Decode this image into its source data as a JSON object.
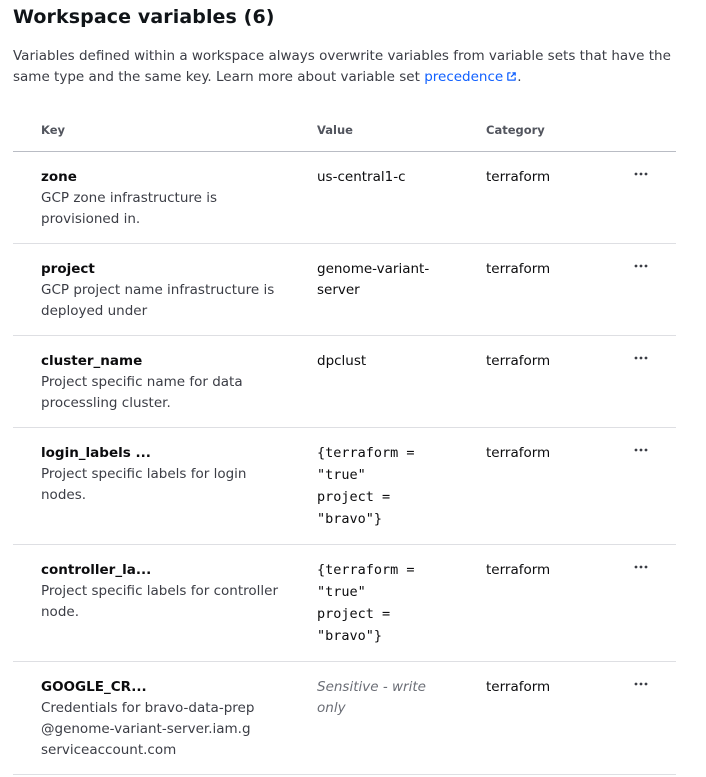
{
  "header": {
    "title": "Workspace variables (6)"
  },
  "intro": {
    "text": "Variables defined within a workspace always overwrite variables from variable sets that have the same type and the same key. Learn more about variable set ",
    "link_label": "precedence",
    "suffix": "."
  },
  "table": {
    "columns": {
      "key": "Key",
      "value": "Value",
      "category": "Category"
    },
    "rows": [
      {
        "key": "zone",
        "description": "GCP zone infrastructure is provisioned in.",
        "value": "us-central1-c",
        "category": "terraform"
      },
      {
        "key": "project",
        "description": "GCP project name infrastructure is deployed under",
        "value": "genome-variant-server",
        "category": "terraform"
      },
      {
        "key": "cluster_name",
        "description": "Project specific name for data processling cluster.",
        "value": "dpclust",
        "category": "terraform"
      },
      {
        "key": "login_labels ...",
        "description": "Project specific labels for login nodes.",
        "value": "{terraform =\n\"true\"\nproject =\n\"bravo\"}",
        "category": "terraform"
      },
      {
        "key": "controller_la...",
        "description": "Project specific labels for controller node.",
        "value": "{terraform =\n\"true\"\nproject =\n\"bravo\"}",
        "category": "terraform"
      },
      {
        "key": "GOOGLE_CR...",
        "description": "Credentials for bravo-data-prep@genome-variant-server.iam.gserviceaccount.com",
        "value": "Sensitive - write only",
        "category": "terraform"
      }
    ]
  },
  "icons": {
    "external_link": "external-link-icon",
    "row_menu": "more-horizontal-icon"
  },
  "colors": {
    "link": "#1060ff",
    "border": "#dedfe3",
    "header_border": "#b9bcc4"
  }
}
